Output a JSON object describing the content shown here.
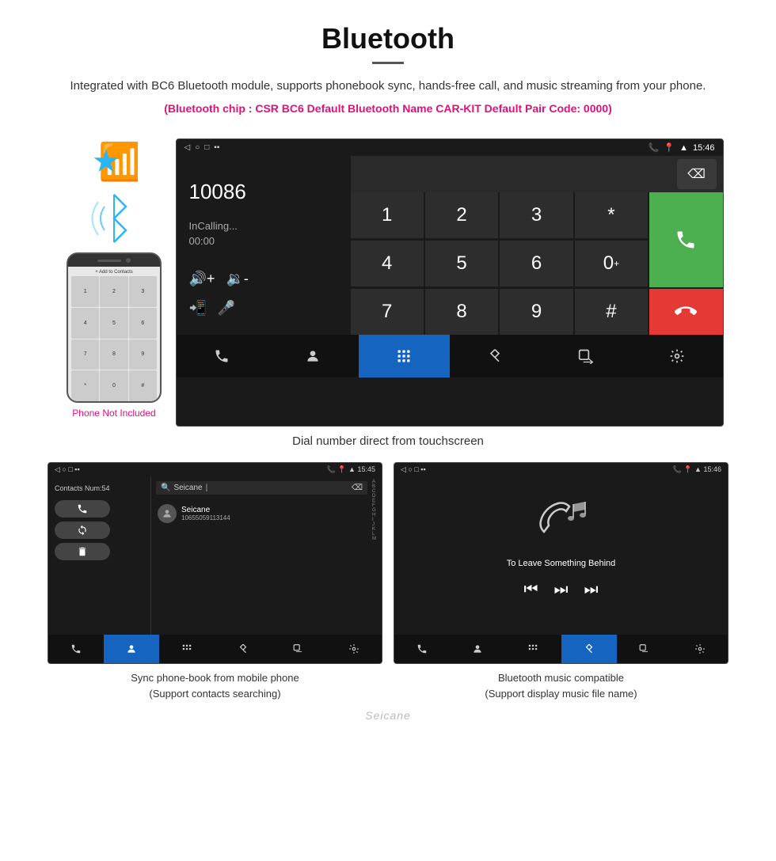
{
  "header": {
    "title": "Bluetooth",
    "description": "Integrated with BC6 Bluetooth module, supports phonebook sync, hands-free call, and music streaming from your phone.",
    "specs": "(Bluetooth chip : CSR BC6    Default Bluetooth Name CAR-KIT    Default Pair Code: 0000)"
  },
  "phone_thumb": {
    "not_included": "Phone Not Included"
  },
  "dial_screen": {
    "statusbar_time": "15:46",
    "number": "10086",
    "status": "InCalling...",
    "timer": "00:00",
    "keys": [
      "1",
      "2",
      "3",
      "*",
      "4",
      "5",
      "6",
      "0+",
      "7",
      "8",
      "9",
      "#"
    ]
  },
  "main_caption": "Dial number direct from touchscreen",
  "contacts_screen": {
    "statusbar_time": "15:45",
    "contacts_num": "Contacts Num:54",
    "search_placeholder": "Seicane",
    "contact_number": "10655059113144",
    "alpha_letters": [
      "A",
      "B",
      "C",
      "D",
      "E",
      "F",
      "G",
      "H",
      "I",
      "J",
      "K",
      "L",
      "M"
    ]
  },
  "music_screen": {
    "statusbar_time": "15:46",
    "song_title": "To Leave Something Behind"
  },
  "bottom_captions": {
    "left_line1": "Sync phone-book from mobile phone",
    "left_line2": "(Support contacts searching)",
    "right_line1": "Bluetooth music compatible",
    "right_line2": "(Support display music file name)"
  },
  "watermark": "Seicane",
  "nav_icons": {
    "phone": "📞",
    "contacts": "👤",
    "keypad": "⌨",
    "bluetooth": "✱",
    "transfer": "⬡",
    "settings": "⚙"
  }
}
